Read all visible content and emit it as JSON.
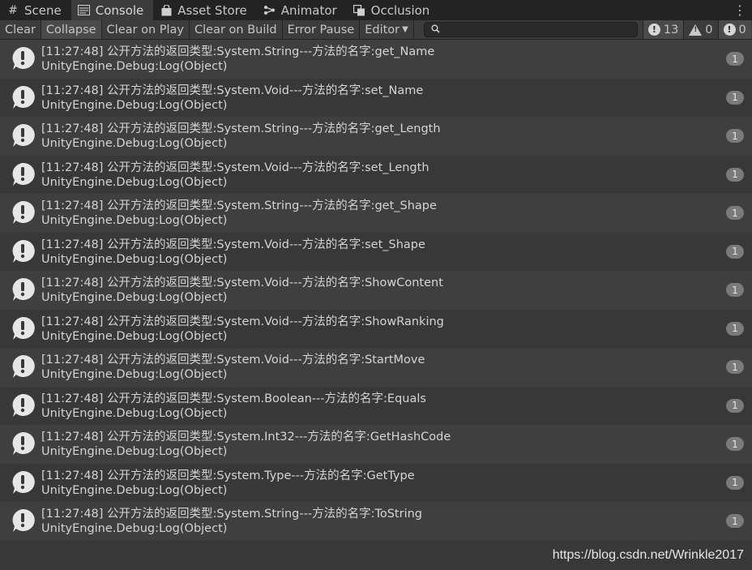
{
  "tabs": [
    {
      "label": "Scene",
      "icon": "grid-icon",
      "active": false
    },
    {
      "label": "Console",
      "icon": "console-icon",
      "active": true
    },
    {
      "label": "Asset Store",
      "icon": "bag-icon",
      "active": false
    },
    {
      "label": "Animator",
      "icon": "animator-icon",
      "active": false
    },
    {
      "label": "Occlusion",
      "icon": "occlusion-icon",
      "active": false
    }
  ],
  "toolbar": {
    "clear": "Clear",
    "collapse": "Collapse",
    "clear_on_play": "Clear on Play",
    "clear_on_build": "Clear on Build",
    "error_pause": "Error Pause",
    "editor": "Editor",
    "search_value": "",
    "log_count": "13",
    "warning_count": "0",
    "error_count": "0"
  },
  "entries": [
    {
      "line1": "[11:27:48] 公开方法的返回类型:System.String---方法的名字:get_Name",
      "line2": "UnityEngine.Debug:Log(Object)",
      "count": "1"
    },
    {
      "line1": "[11:27:48] 公开方法的返回类型:System.Void---方法的名字:set_Name",
      "line2": "UnityEngine.Debug:Log(Object)",
      "count": "1"
    },
    {
      "line1": "[11:27:48] 公开方法的返回类型:System.String---方法的名字:get_Length",
      "line2": "UnityEngine.Debug:Log(Object)",
      "count": "1"
    },
    {
      "line1": "[11:27:48] 公开方法的返回类型:System.Void---方法的名字:set_Length",
      "line2": "UnityEngine.Debug:Log(Object)",
      "count": "1"
    },
    {
      "line1": "[11:27:48] 公开方法的返回类型:System.String---方法的名字:get_Shape",
      "line2": "UnityEngine.Debug:Log(Object)",
      "count": "1"
    },
    {
      "line1": "[11:27:48] 公开方法的返回类型:System.Void---方法的名字:set_Shape",
      "line2": "UnityEngine.Debug:Log(Object)",
      "count": "1"
    },
    {
      "line1": "[11:27:48] 公开方法的返回类型:System.Void---方法的名字:ShowContent",
      "line2": "UnityEngine.Debug:Log(Object)",
      "count": "1"
    },
    {
      "line1": "[11:27:48] 公开方法的返回类型:System.Void---方法的名字:ShowRanking",
      "line2": "UnityEngine.Debug:Log(Object)",
      "count": "1"
    },
    {
      "line1": "[11:27:48] 公开方法的返回类型:System.Void---方法的名字:StartMove",
      "line2": "UnityEngine.Debug:Log(Object)",
      "count": "1"
    },
    {
      "line1": "[11:27:48] 公开方法的返回类型:System.Boolean---方法的名字:Equals",
      "line2": "UnityEngine.Debug:Log(Object)",
      "count": "1"
    },
    {
      "line1": "[11:27:48] 公开方法的返回类型:System.Int32---方法的名字:GetHashCode",
      "line2": "UnityEngine.Debug:Log(Object)",
      "count": "1"
    },
    {
      "line1": "[11:27:48] 公开方法的返回类型:System.Type---方法的名字:GetType",
      "line2": "UnityEngine.Debug:Log(Object)",
      "count": "1"
    },
    {
      "line1": "[11:27:48] 公开方法的返回类型:System.String---方法的名字:ToString",
      "line2": "UnityEngine.Debug:Log(Object)",
      "count": "1"
    }
  ],
  "watermark": "https://blog.csdn.net/Wrinkle2017",
  "colors": {
    "background": "#383838",
    "row_alt": "#3f3f3f",
    "tabbar": "#232323",
    "badge": "#7a7a7a"
  }
}
